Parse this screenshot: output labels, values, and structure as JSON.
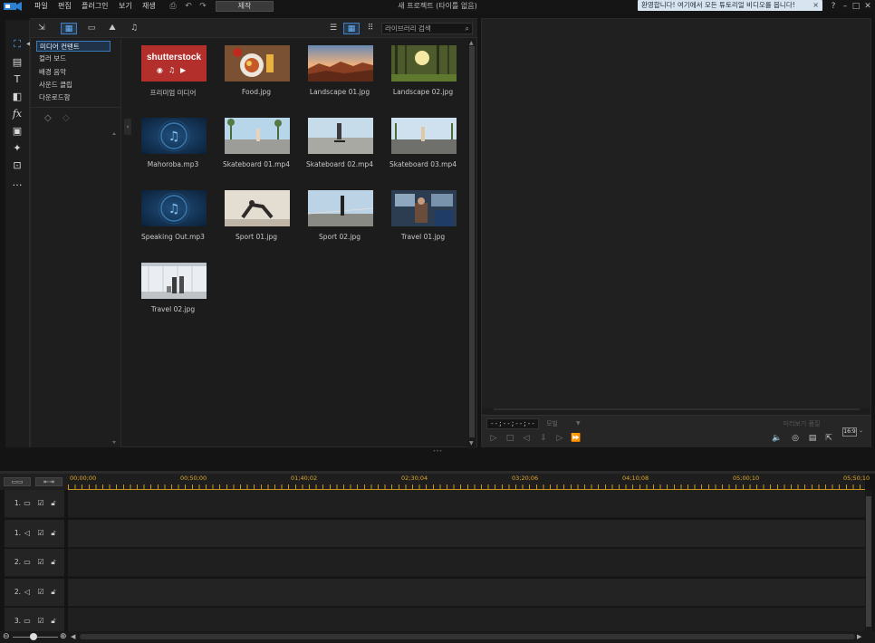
{
  "menu": {
    "items": [
      "파일",
      "편집",
      "플러그인",
      "보기",
      "재생"
    ],
    "produce_label": "제작",
    "project_title": "새 프로젝트 (타이틀 없음)",
    "welcome_text": "환영합니다! 여기에서 모든 튜토리얼 비디오를 봅니다!",
    "help": "?"
  },
  "library": {
    "search_placeholder": "라이브러리 검색",
    "categories": [
      "미디어 컨텐트",
      "컬러 보드",
      "배경 음악",
      "사운드 클립",
      "다운로드함"
    ],
    "selected_category": "미디어 컨텐트",
    "items": [
      {
        "caption": "프리미엄 미디어",
        "kind": "shutterstock",
        "logo_text": "shutterstock"
      },
      {
        "caption": "Food.jpg",
        "kind": "food"
      },
      {
        "caption": "Landscape 01.jpg",
        "kind": "landscape1"
      },
      {
        "caption": "Landscape 02.jpg",
        "kind": "landscape2"
      },
      {
        "caption": "Mahoroba.mp3",
        "kind": "audio"
      },
      {
        "caption": "Skateboard 01.mp4",
        "kind": "skate1"
      },
      {
        "caption": "Skateboard 02.mp4",
        "kind": "skate2"
      },
      {
        "caption": "Skateboard 03.mp4",
        "kind": "skate3"
      },
      {
        "caption": "Speaking Out.mp3",
        "kind": "audio"
      },
      {
        "caption": "Sport 01.jpg",
        "kind": "sport1"
      },
      {
        "caption": "Sport 02.jpg",
        "kind": "sport2"
      },
      {
        "caption": "Travel 01.jpg",
        "kind": "travel1"
      },
      {
        "caption": "Travel 02.jpg",
        "kind": "travel2"
      }
    ]
  },
  "preview": {
    "timecode": "--;--;--;--",
    "quality_label": "모빌",
    "hq_preview_label": "미리보기 품질",
    "aspect_ratio": "16:9"
  },
  "timeline": {
    "ruler_labels": [
      "00;00;00",
      "00;50;00",
      "01;40;02",
      "02;30;04",
      "03;20;06",
      "04;10;08",
      "05;00;10",
      "05;50;10"
    ],
    "tracks": [
      {
        "num": "1.",
        "type": "video"
      },
      {
        "num": "1.",
        "type": "audio"
      },
      {
        "num": "2.",
        "type": "video"
      },
      {
        "num": "2.",
        "type": "audio"
      },
      {
        "num": "3.",
        "type": "video"
      }
    ]
  },
  "colors": {
    "accent": "#3d7fc2",
    "ruler": "#e3a92a",
    "shutterstock_red": "#b32f2b"
  }
}
